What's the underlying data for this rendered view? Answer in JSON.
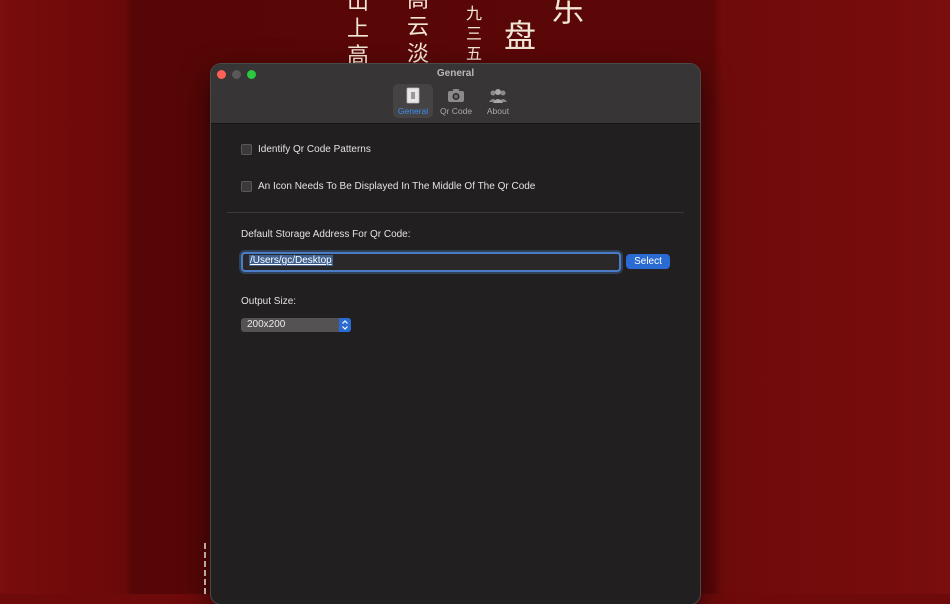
{
  "wallpaper": {
    "col1": [
      "山",
      "上",
      "高"
    ],
    "col2": [
      "高",
      "云",
      "淡"
    ],
    "col3": [
      "九",
      "三",
      "五"
    ],
    "col4": "盘",
    "col5": "乐"
  },
  "window": {
    "title": "General",
    "toolbar": [
      {
        "label": "General",
        "icon": "general-icon",
        "selected": true
      },
      {
        "label": "Qr Code",
        "icon": "camera-icon",
        "selected": false
      },
      {
        "label": "About",
        "icon": "people-icon",
        "selected": false
      }
    ]
  },
  "settings": {
    "identify_patterns": {
      "label": "Identify Qr Code Patterns",
      "checked": false
    },
    "center_icon": {
      "label": "An Icon Needs To Be Displayed In The Middle Of The Qr Code",
      "checked": false
    },
    "storage": {
      "label": "Default Storage Address For Qr Code:",
      "value": "/Users/gc/Desktop",
      "button": "Select"
    },
    "output_size": {
      "label": "Output Size:",
      "value": "200x200"
    }
  },
  "colors": {
    "accent": "#2a6ad3",
    "selected_tab": "#3b8ef5",
    "wallpaper": "#5c0707"
  }
}
